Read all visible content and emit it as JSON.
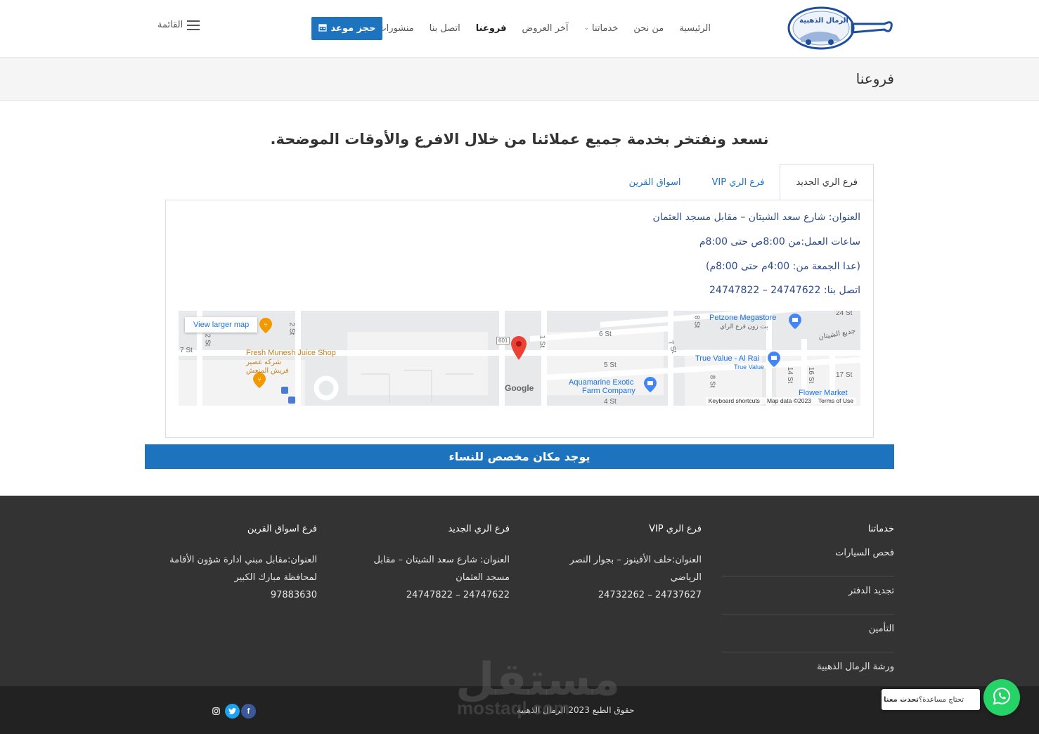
{
  "header": {
    "logo_text": "الرمال الذهبية",
    "nav": [
      {
        "label": "الرئيسية",
        "dropdown": false,
        "active": false
      },
      {
        "label": "من نحن",
        "dropdown": false,
        "active": false
      },
      {
        "label": "خدماتنا",
        "dropdown": true,
        "active": false
      },
      {
        "label": "آخر العروض",
        "dropdown": false,
        "active": false
      },
      {
        "label": "فروعنا",
        "dropdown": false,
        "active": true
      },
      {
        "label": "اتصل بنا",
        "dropdown": false,
        "active": false
      },
      {
        "label": "منشورات",
        "dropdown": true,
        "active": false
      }
    ],
    "book_label": "حجز موعد",
    "menu_label": "القائمة"
  },
  "page_title": "فروعنا",
  "intro": "نسعد ونفتخر بخدمة جميع عملائنا من خلال الافرع والأوقات الموضحة.",
  "tabs": [
    {
      "label": "فرع الري الجديد",
      "active": true
    },
    {
      "label": "فرع الري VIP",
      "active": false
    },
    {
      "label": "اسواق القرين",
      "active": false
    }
  ],
  "branch": {
    "address": "العنوان: شارع سعد الشيتان – مقابل مسجد العثمان",
    "hours": "ساعات العمل:من 8:00ص حتى 8:00م",
    "friday": "(عدا الجمعة من: 4:00م حتى 8:00م)",
    "phone": "اتصل بنا: 24747622 – 24747822"
  },
  "map": {
    "view_larger": "View larger map",
    "labels": {
      "juice": "Fresh Munesh Juice Shop",
      "juice_ar1": "شركه عصير",
      "juice_ar2": "فريش المنعش",
      "petzone": "Petzone Megastore",
      "petzone_ar": "بت زون فرع الراي",
      "truevalue": "True Value - Al Rai",
      "truevalue_sub": "True Value",
      "aquamarine1": "Aquamarine Exotic",
      "aquamarine2": "Farm Company",
      "flower": "Flower Market",
      "road601": "601",
      "st_2a": "2 St",
      "st_2b": "2 St",
      "st_7": "7 St",
      "st_1": "1 St",
      "st_6": "6 St",
      "st_5": "5 St",
      "st_4": "4 St",
      "st_8a": "8 St",
      "st_8b": "8 St",
      "st_7b": "7 St",
      "st_14": "14 St",
      "st_16": "16 St",
      "st_17": "17 St",
      "st_24": "24 St",
      "shitan": "جدیع الشیتان"
    },
    "google": "Google",
    "footer_keys": "Keyboard shortcuts",
    "footer_data": "Map data ©2023",
    "footer_terms": "Terms of Use"
  },
  "banner": "يوجد مكان مخصص للنساء",
  "footer": {
    "services_title": "خدماتنا",
    "services": [
      "فحص السيارات",
      "تجديد الدفتر",
      "التأمين",
      "ورشة الرمال الذهبية"
    ],
    "vip": {
      "title": "فرع الري VIP",
      "address": "العنوان:خلف الأفينوز – بجوار النصر الرياضي",
      "phone": "24737627 – 24732262"
    },
    "new": {
      "title": "فرع الري الجديد",
      "address": "العنوان: شارع سعد الشيتان – مقابل مسجد العثمان",
      "phone": "24747622 – 24747822"
    },
    "qurain": {
      "title": "فرع اسواق القرين",
      "address": "العنوان:مقابل مبني ادارة شؤون الأقامة لمحافظة مبارك الكبير",
      "phone": "97883630"
    },
    "copyright": "حقوق الطبع 2023 الرمال الذهبية"
  },
  "watermark": {
    "ar": "مستقل",
    "en": "mostaql.com"
  },
  "whatsapp": {
    "question": "تحتاج مساعدة؟",
    "cta": "تحدث معنا"
  },
  "colors": {
    "primary": "#1e73be",
    "footer_bg": "#333333",
    "copy_bg": "#222222",
    "whatsapp": "#25d366"
  }
}
